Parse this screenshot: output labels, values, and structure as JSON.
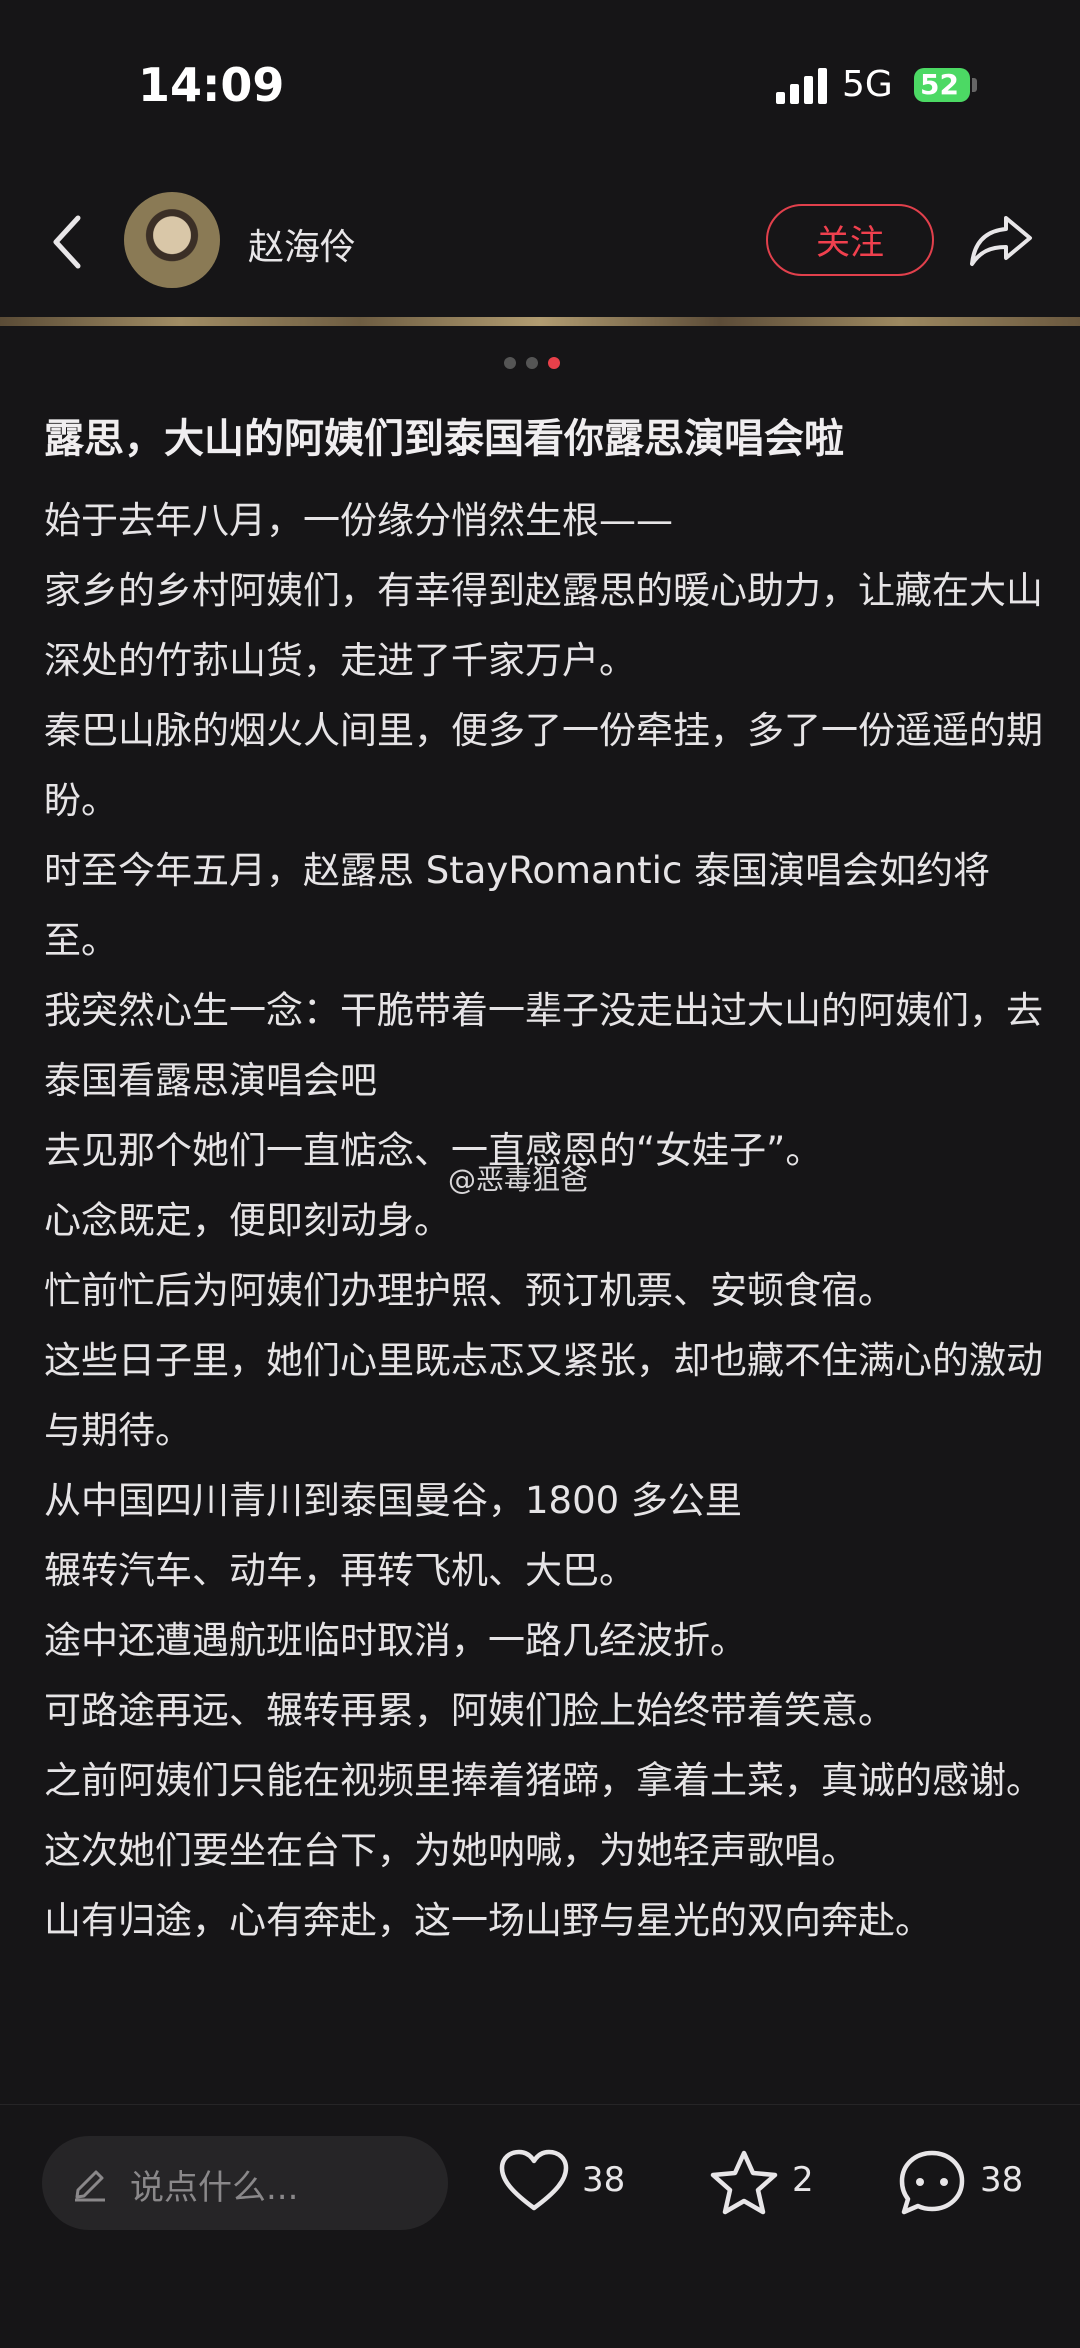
{
  "status_bar": {
    "time": "14:09",
    "network": "5G",
    "battery": "52"
  },
  "header": {
    "username": "赵海伶",
    "follow_label": "关注"
  },
  "post": {
    "title": "露思，大山的阿姨们到泰国看你露思演唱会啦",
    "paragraphs": [
      "始于去年八月，一份缘分悄然生根——",
      "家乡的乡村阿姨们，有幸得到赵露思的暖心助力，让藏在大山深处的竹荪山货，走进了千家万户。",
      "秦巴山脉的烟火人间里，便多了一份牵挂，多了一份遥遥的期盼。",
      "时至今年五月，赵露思 StayRomantic 泰国演唱会如约将至。",
      "我突然心生一念：干脆带着一辈子没走出过大山的阿姨们，去泰国看露思演唱会吧",
      "去见那个她们一直惦念、一直感恩的“女娃子”。",
      "心念既定，便即刻动身。",
      "忙前忙后为阿姨们办理护照、预订机票、安顿食宿。",
      "这些日子里，她们心里既忐忑又紧张，却也藏不住满心的激动与期待。",
      "从中国四川青川到泰国曼谷，1800 多公里",
      "辗转汽车、动车，再转飞机、大巴。",
      "途中还遭遇航班临时取消，一路几经波折。",
      "可路途再远、辗转再累，阿姨们脸上始终带着笑意。",
      "之前阿姨们只能在视频里捧着猪蹄，拿着土菜，真诚的感谢。",
      "这次她们要坐在台下，为她呐喊，为她轻声歌唱。",
      "山有归途，心有奔赴，这一场山野与星光的双向奔赴。"
    ],
    "watermark": "@恶毒狙爸"
  },
  "bottom_bar": {
    "comment_placeholder": "说点什么...",
    "like_count": "38",
    "favorite_count": "2",
    "comment_count": "38"
  },
  "colors": {
    "accent": "#e8404a",
    "background": "#161517"
  }
}
